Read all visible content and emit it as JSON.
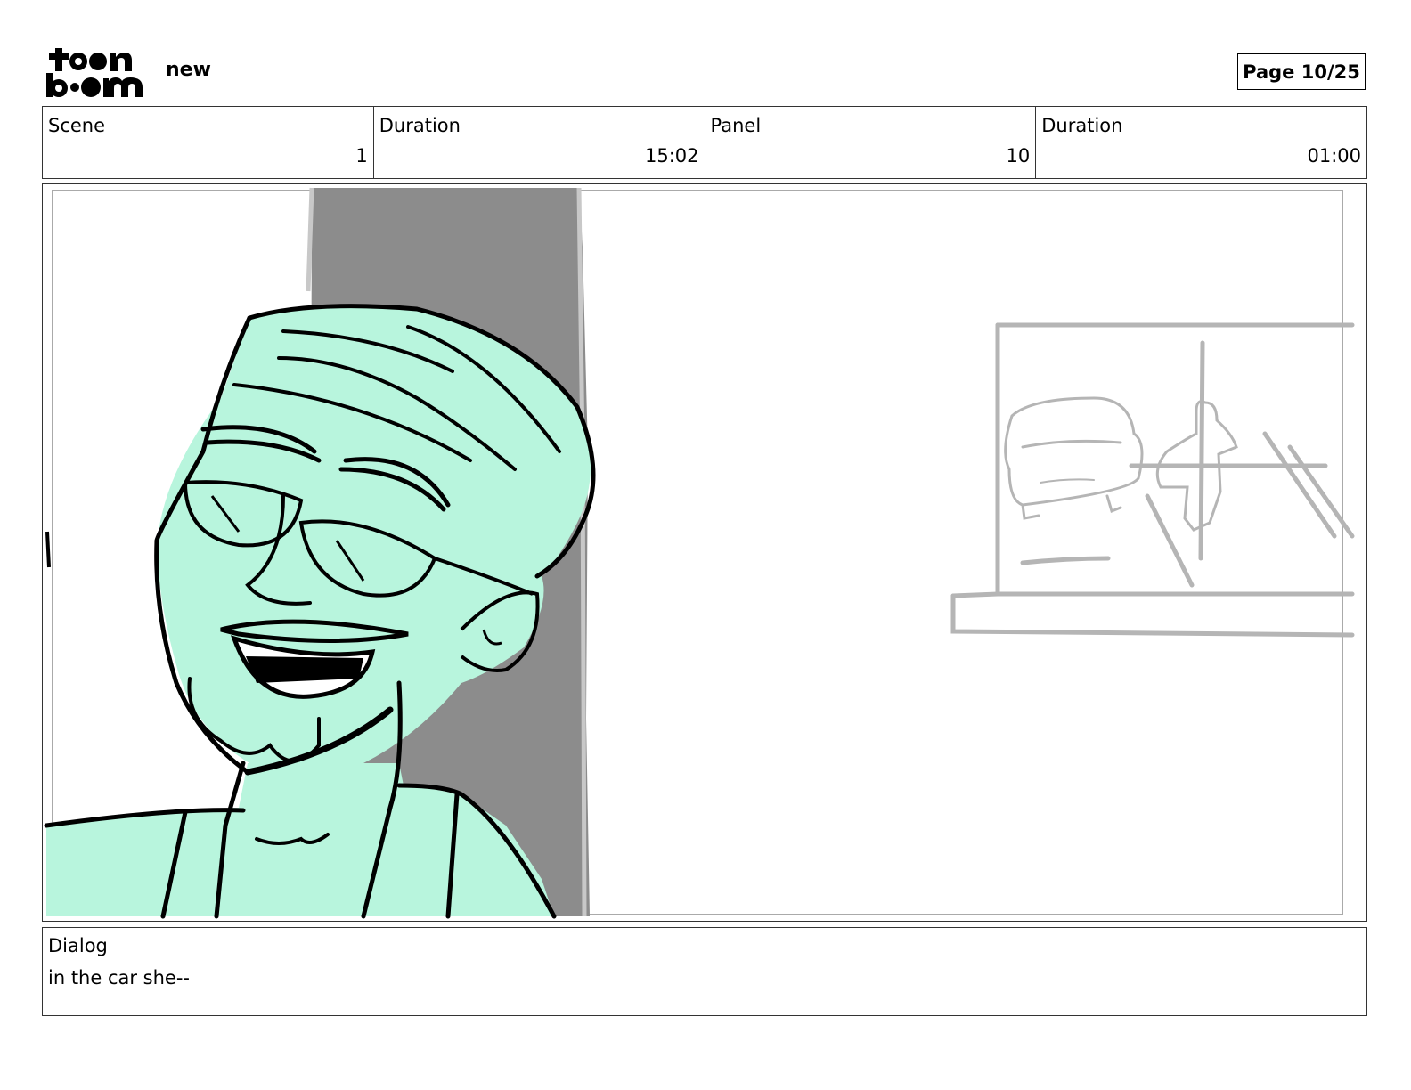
{
  "header": {
    "logo_line1": "toon",
    "logo_line2": "boom",
    "project_title": "new",
    "page_indicator": "Page 10/25"
  },
  "info": {
    "scene_label": "Scene",
    "scene_value": "1",
    "scene_duration_label": "Duration",
    "scene_duration_value": "15:02",
    "panel_label": "Panel",
    "panel_value": "10",
    "panel_duration_label": "Duration",
    "panel_duration_value": "01:00"
  },
  "panel_image": {
    "icon": "storyboard-sketch",
    "colors": {
      "skin": "#b8f5dd",
      "pillar": "#8c8c8c",
      "line": "#000000",
      "background_sketch": "#b5b5b5"
    }
  },
  "dialog": {
    "label": "Dialog",
    "text": "in the car she--"
  }
}
